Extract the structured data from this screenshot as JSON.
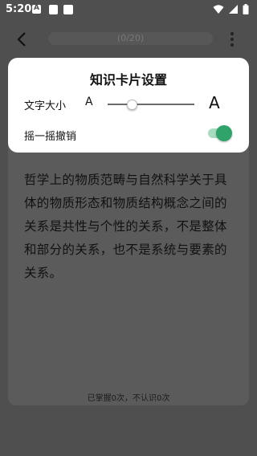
{
  "status_bar": {
    "time": "5:20",
    "icons": [
      "a-badge-icon",
      "square-icon",
      "square-icon",
      "wifi-icon",
      "signal-icon",
      "battery-icon"
    ]
  },
  "nav": {
    "back_icon": "chevron-left-icon",
    "progress_text": "(0/20)",
    "more_icon": "more-vertical-icon"
  },
  "settings": {
    "title": "知识卡片设置",
    "font_size_label": "文字大小",
    "font_small_glyph": "A",
    "font_large_glyph": "A",
    "font_size_level": 0.28,
    "shake_undo_label": "摇一摇撤销",
    "shake_undo_enabled": true,
    "accent_color": "#2fa36a"
  },
  "card": {
    "text": "哲学上的物质范畴与自然科学关于具体的物质形态和物质结构概念之间的关系是共性与个性的关系，不是整体和部分的关系，也不是系统与要素的关系。",
    "footer": "已掌握0次，不认识0次"
  }
}
